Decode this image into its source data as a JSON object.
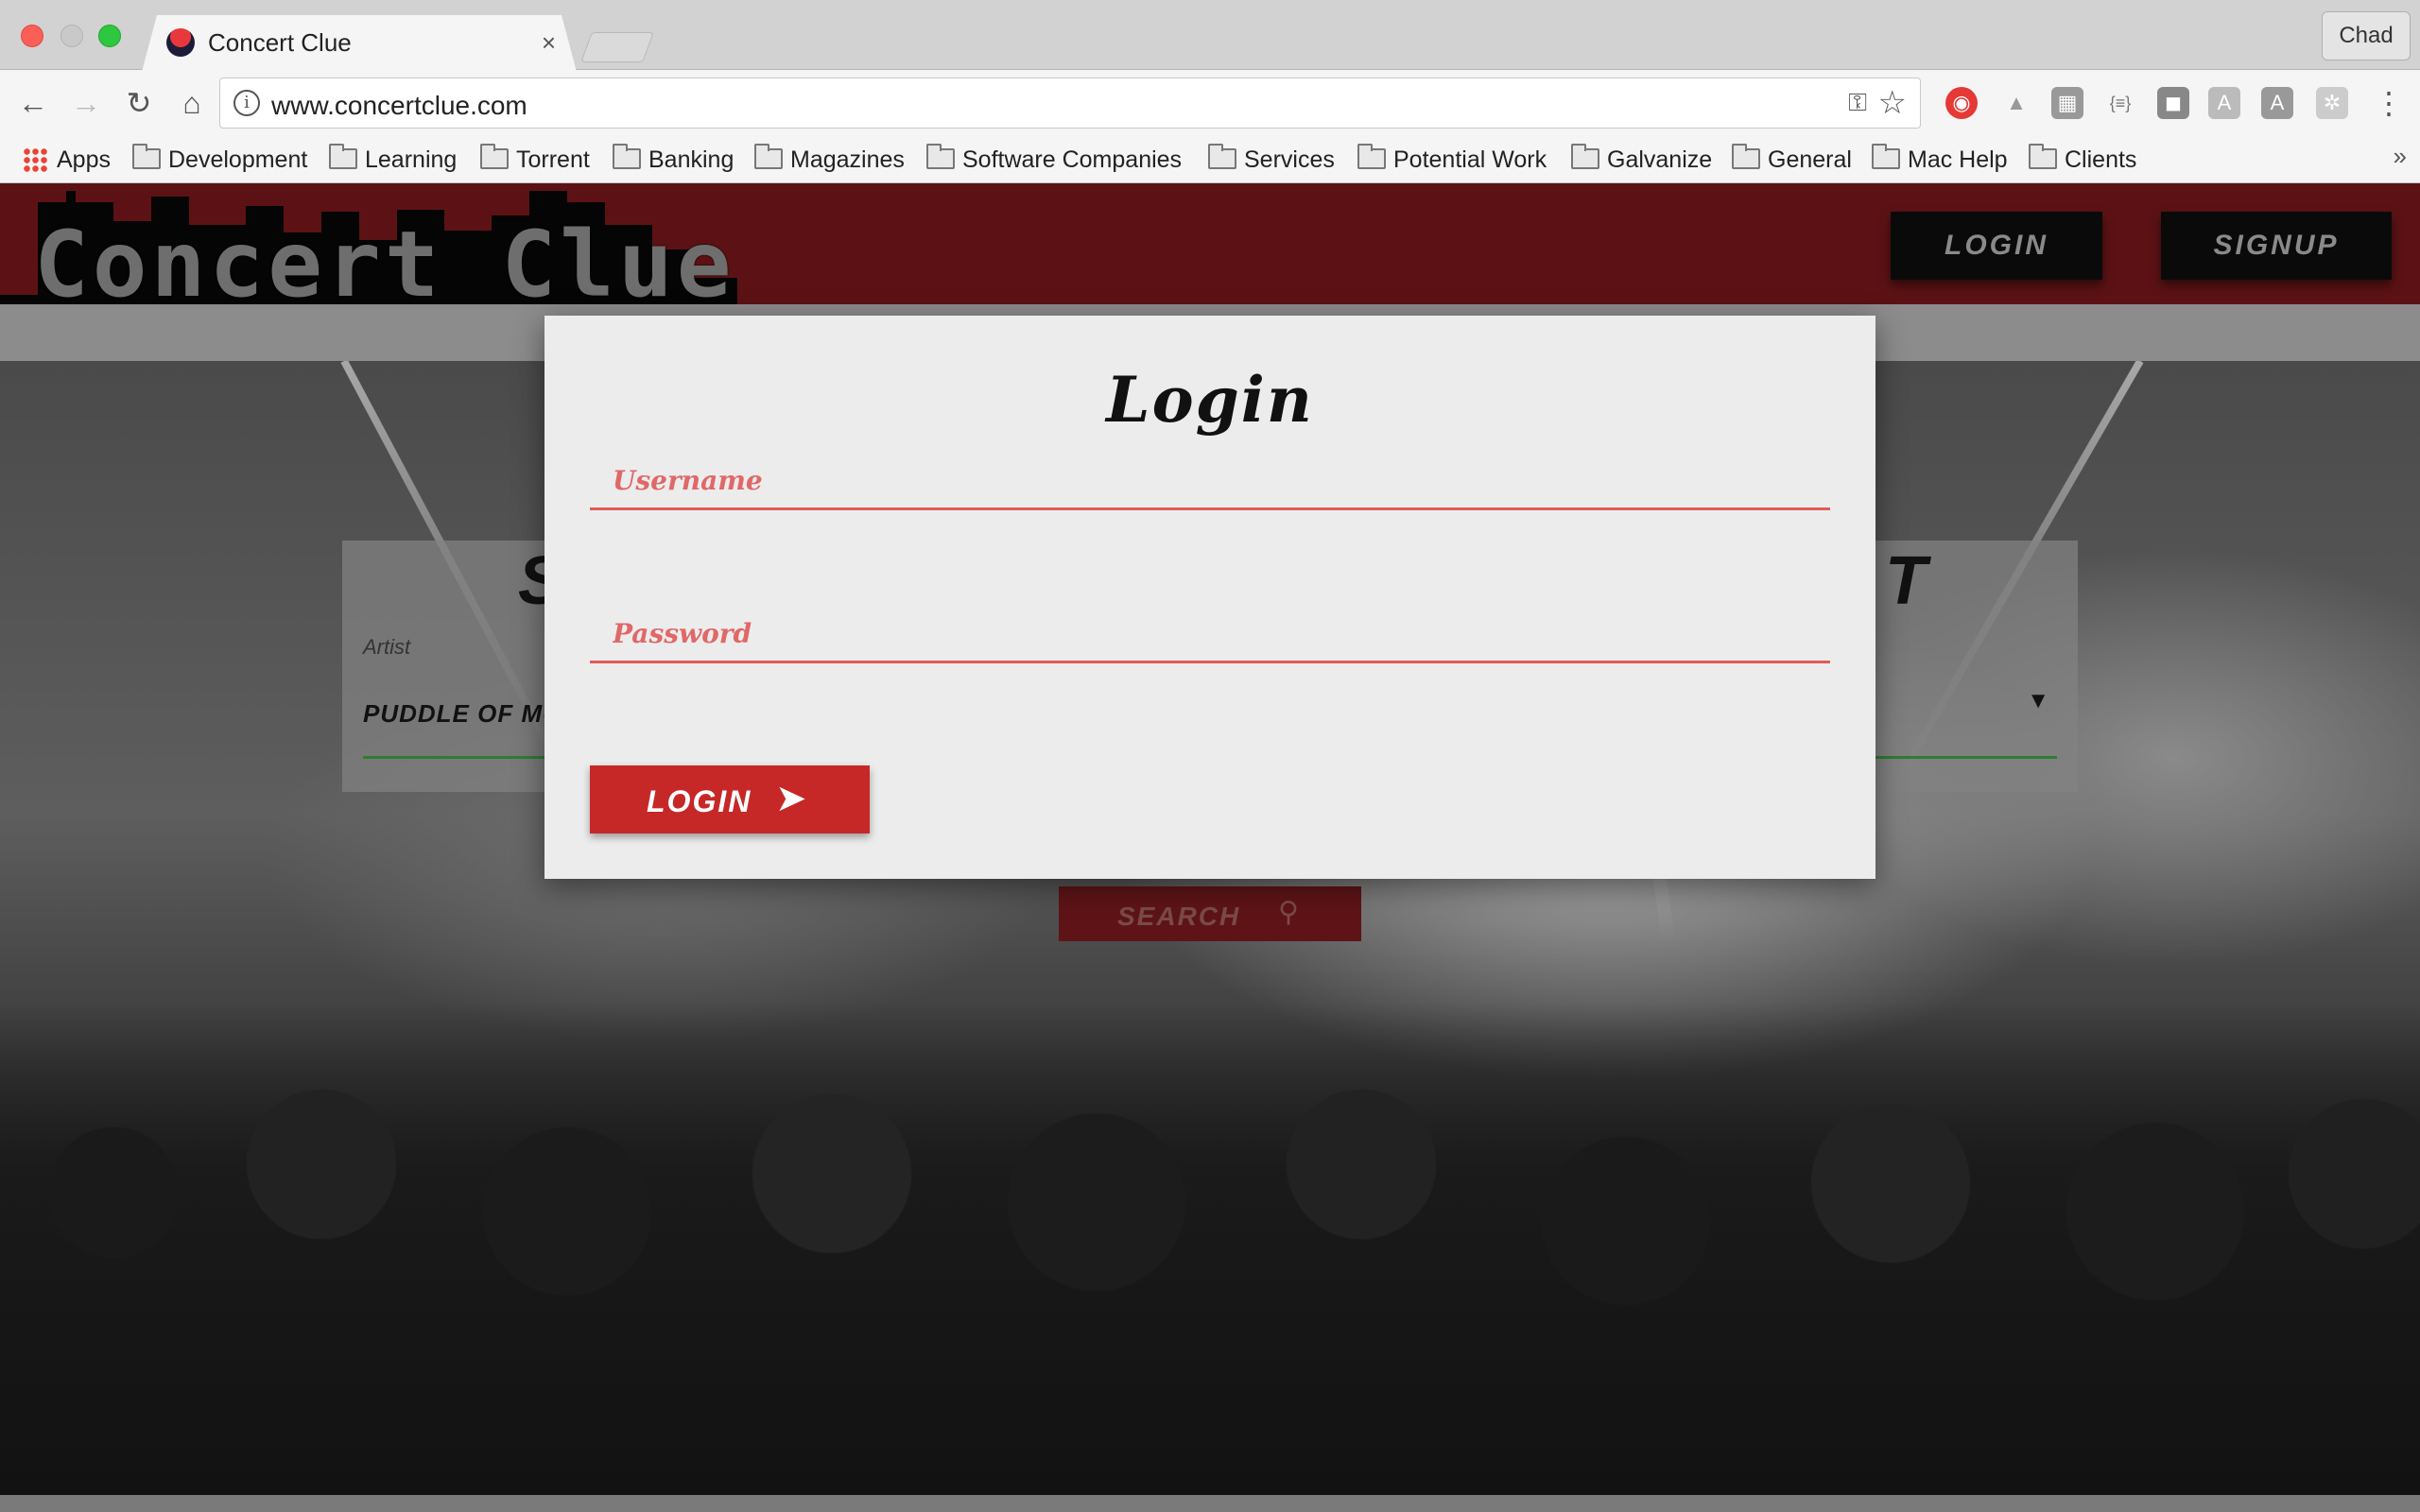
{
  "browser": {
    "tab_title": "Concert Clue",
    "tab_close": "×",
    "profile_name": "Chad",
    "url": "www.concertclue.com",
    "nav": {
      "back": "←",
      "forward": "→",
      "reload": "↻",
      "home": "⌂"
    },
    "omnibox_info": "i",
    "omnibox_key": "⚿",
    "omnibox_star": "☆",
    "menu": "⋮",
    "extensions": [
      "opera-icon",
      "drive-icon",
      "gallery-icon",
      "json-icon",
      "shield-icon",
      "angular-icon",
      "text-icon",
      "gear-icon"
    ],
    "extension_glyphs": [
      "◉",
      "▲",
      "▦",
      "{≡}",
      "◼",
      "A",
      "A",
      "✲"
    ],
    "bookmarks": [
      "Apps",
      "Development",
      "Learning",
      "Torrent",
      "Banking",
      "Magazines",
      "Software Companies",
      "Services",
      "Potential Work",
      "Galvanize",
      "General",
      "Mac Help",
      "Clients"
    ],
    "bookmarks_more": "»"
  },
  "site": {
    "logo_text": "Concert Clue",
    "header_login": "LOGIN",
    "header_signup": "SIGNUP",
    "search_panel": {
      "heading_left": "S",
      "heading_right": "T",
      "artist_label": "Artist",
      "artist_value": "PUDDLE OF MU",
      "dropdown_caret": "▼"
    },
    "search_button": "SEARCH",
    "search_icon": "⚲"
  },
  "modal": {
    "title": "Login",
    "username_placeholder": "Username",
    "password_placeholder": "Password",
    "submit_label": "LOGIN",
    "submit_icon": "➤"
  },
  "colors": {
    "header_bg": "#5c1214",
    "accent_red": "#c62828",
    "field_underline": "#e05a5a",
    "modal_bg": "#ececec"
  }
}
